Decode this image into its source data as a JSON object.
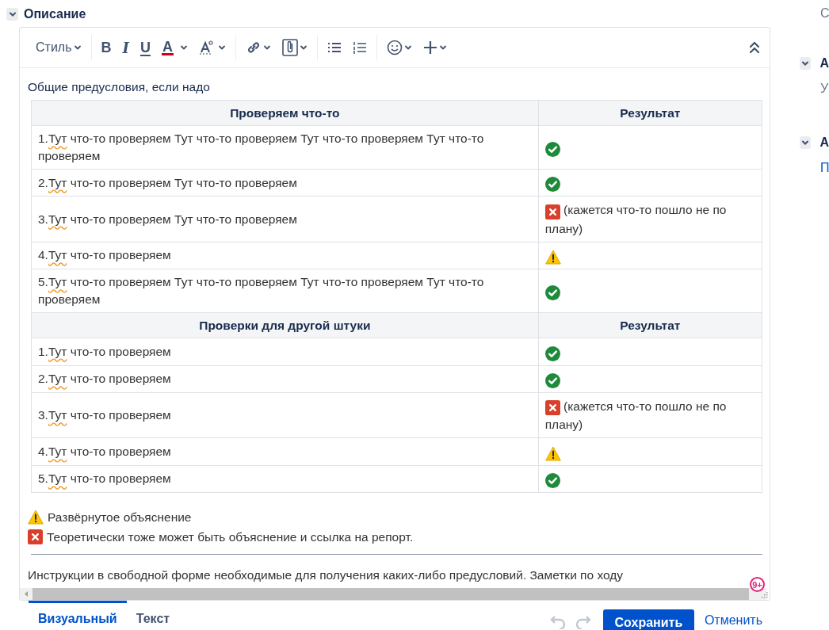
{
  "section": {
    "title": "Описание",
    "expanded": true
  },
  "toolbar": {
    "style_label": "Стиль",
    "format_buttons": [
      {
        "label": "B",
        "kind": "bold"
      },
      {
        "label": "I",
        "kind": "italic"
      },
      {
        "label": "U",
        "kind": "underline"
      },
      {
        "label": "A",
        "kind": "color",
        "color": "#d0021b"
      }
    ]
  },
  "intro": "Общие предусловия, если надо",
  "table": {
    "groups": [
      {
        "columns": [
          "Проверяем что-то",
          "Результат"
        ],
        "rows": [
          {
            "number": "1.",
            "flagged_word": "Тут",
            "text": " что-то проверяем Тут что-то проверяем Тут что-то проверяем Тут что-то проверяем",
            "kind": "ok"
          },
          {
            "number": "2.",
            "flagged_word": "Тут",
            "text": " что-то проверяем Тут что-то проверяем",
            "kind": "ok"
          },
          {
            "number": "3.",
            "flagged_word": "Тут",
            "text": " что-то проверяем Тут что-то проверяем",
            "kind": "fail",
            "note": "(кажется что-то пошло не по плану)"
          },
          {
            "number": "4.",
            "flagged_word": "Тут",
            "text": " что-то проверяем",
            "kind": "warn"
          },
          {
            "number": "5.",
            "flagged_word": "Тут",
            "text": " что-то проверяем Тут что-то проверяем Тут что-то проверяем Тут что-то проверяем",
            "kind": "ok"
          }
        ]
      },
      {
        "columns": [
          "Проверки для другой штуки",
          "Результат"
        ],
        "rows": [
          {
            "number": "1.",
            "flagged_word": "Тут",
            "text": " что-то проверяем",
            "kind": "ok"
          },
          {
            "number": "2.",
            "flagged_word": "Тут",
            "text": " что-то проверяем",
            "kind": "ok"
          },
          {
            "number": "3.",
            "flagged_word": "Тут",
            "text": " что-то проверяем",
            "kind": "fail",
            "note": "(кажется что-то пошло не по плану)"
          },
          {
            "number": "4.",
            "flagged_word": "Тут",
            "text": " что-то проверяем",
            "kind": "warn"
          },
          {
            "number": "5.",
            "flagged_word": "Тут",
            "text": " что-то проверяем",
            "kind": "ok"
          }
        ]
      }
    ]
  },
  "legend": [
    {
      "kind": "warn",
      "text": "Развёрнутое объяснение"
    },
    {
      "kind": "fail",
      "text": "Теоретически тоже может быть объяснение и ссылка на репорт."
    }
  ],
  "notes": "Инструкции в свободной форме необходимые для получения каких-либо предусловий. Заметки по ходу",
  "badge": "9+",
  "footer": {
    "tabs": [
      {
        "label": "Визуальный",
        "selected": true
      },
      {
        "label": "Текст",
        "selected": false
      }
    ],
    "undo_disabled": true,
    "save": "Сохранить",
    "cancel": "Отменить"
  },
  "side_panel": {
    "top_text": "С",
    "sections": [
      {
        "title": "А",
        "expanded": true,
        "value": "У",
        "kind": "plain"
      },
      {
        "title": "А",
        "expanded": true,
        "value": "П",
        "kind": "link"
      }
    ]
  }
}
